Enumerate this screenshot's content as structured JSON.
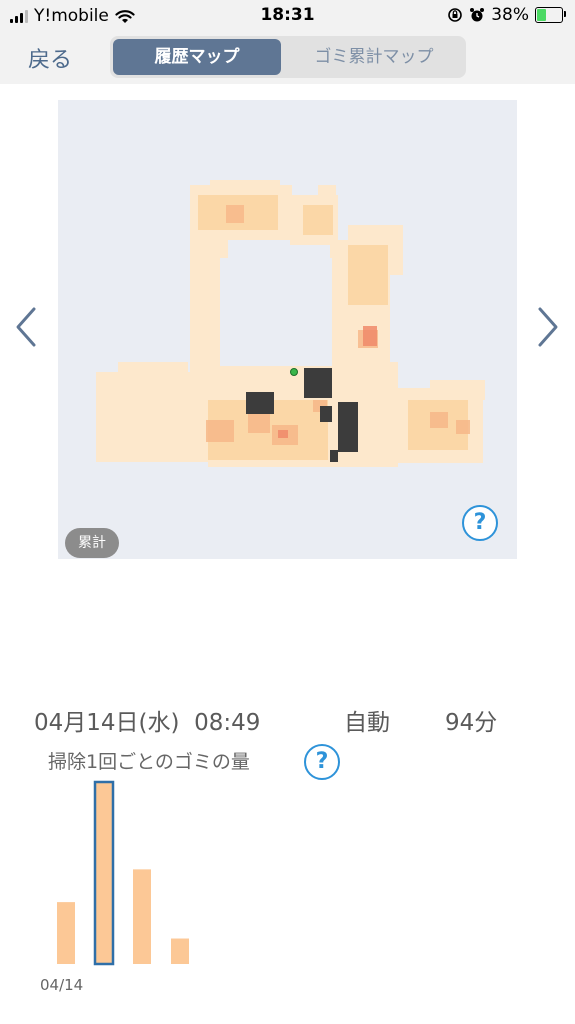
{
  "status_bar": {
    "carrier": "Y!mobile",
    "time": "18:31",
    "battery": "38%"
  },
  "header": {
    "back_label": "戻る",
    "tabs": [
      {
        "label": "履歴マップ",
        "active": true
      },
      {
        "label": "ゴミ累計マップ",
        "active": false
      }
    ]
  },
  "map": {
    "badge": "累計",
    "help": "?"
  },
  "session": {
    "date_time": "04月14日(水)  08:49",
    "mode": "自動",
    "duration": "94分"
  },
  "chart_section": {
    "subtitle": "掃除1回ごとのゴミの量",
    "help": "?"
  },
  "chart_data": {
    "type": "bar",
    "categories": [
      "04/14",
      "",
      "",
      ""
    ],
    "values": [
      3.4,
      10,
      5.2,
      1.4
    ],
    "selected_index": 1,
    "tick_labels": [
      "04/14"
    ],
    "bar_color": "#fcc896",
    "selected_border_color": "#2f6fa8"
  },
  "colors": {
    "accent": "#5f7694",
    "help": "#2e93d9"
  }
}
